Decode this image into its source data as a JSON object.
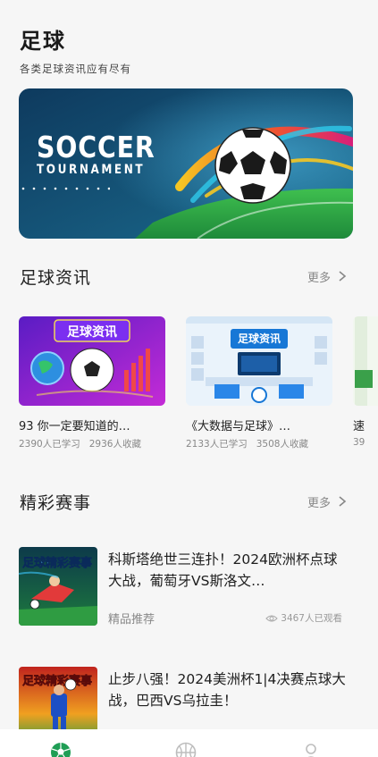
{
  "header": {
    "title": "足球",
    "subtitle": "各类足球资讯应有尽有"
  },
  "banner": {
    "line1": "SOCCER",
    "line2": "TOURNAMENT"
  },
  "news_section": {
    "title": "足球资讯",
    "more_label": "更多",
    "items": [
      {
        "thumb_text": "足球资讯",
        "title": "93 你一定要知道的…",
        "learners": "2390人已学习",
        "favorites": "2936人收藏"
      },
      {
        "thumb_text": "足球资讯",
        "title": "《大数据与足球》…",
        "learners": "2133人已学习",
        "favorites": "3508人收藏"
      },
      {
        "title": "速",
        "learners": "39"
      }
    ]
  },
  "matches_section": {
    "title": "精彩赛事",
    "more_label": "更多",
    "items": [
      {
        "thumb_text": "足球精彩赛事",
        "title": "科斯塔绝世三连扑！2024欧洲杯点球大战，葡萄牙VS斯洛文…",
        "tag": "精品推荐",
        "views": "3467人已观看"
      },
      {
        "thumb_text": "足球精彩赛事",
        "title": "止步八强！2024美洲杯1|4决赛点球大战，巴西VS乌拉圭！"
      }
    ]
  },
  "tabbar": {
    "items": [
      {
        "icon": "soccer-ball-icon",
        "active": true
      },
      {
        "icon": "basketball-icon",
        "active": false
      },
      {
        "icon": "profile-icon",
        "active": false
      }
    ]
  },
  "colors": {
    "accent": "#1f9e55",
    "muted": "#bdbdbd"
  }
}
